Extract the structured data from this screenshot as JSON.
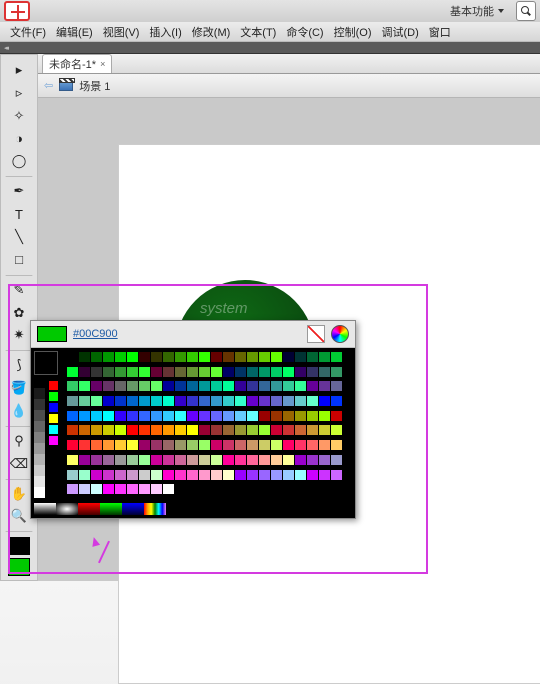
{
  "titlebar": {
    "label": "基本功能"
  },
  "menu": {
    "file": "文件(F)",
    "edit": "编辑(E)",
    "view": "视图(V)",
    "insert": "插入(I)",
    "modify": "修改(M)",
    "text": "文本(T)",
    "command": "命令(C)",
    "control": "控制(O)",
    "debug": "调试(D)",
    "window": "窗口"
  },
  "tab": {
    "name": "未命名-1*",
    "close": "×"
  },
  "scene": {
    "label": "场景 1"
  },
  "picker": {
    "hex": "#00C900",
    "accent": "#00C900"
  },
  "tools": {
    "selection": "▸",
    "subselect": "▹",
    "freetransform": "✧",
    "3d": "◑",
    "lasso": "◯",
    "pen": "✒",
    "text": "T",
    "line": "╲",
    "rect": "□",
    "pencil": "✎",
    "brush": "✿",
    "deco": "✷",
    "bone": "⟆",
    "paint": "🪣",
    "ink": "💧",
    "eraser": "⌫",
    "eyedrop": "⚲",
    "hand": "✋",
    "zoom": "🔍"
  },
  "swatches": {
    "stroke": "#000000",
    "fill": "#00C900"
  },
  "grays": [
    "#000",
    "#1a1a1a",
    "#333",
    "#4d4d4d",
    "#666",
    "#808080",
    "#999",
    "#b3b3b3",
    "#ccc",
    "#e6e6e6",
    "#fff"
  ],
  "basic": [
    "#f00",
    "#0f0",
    "#00f",
    "#ff0",
    "#0ff",
    "#f0f"
  ]
}
